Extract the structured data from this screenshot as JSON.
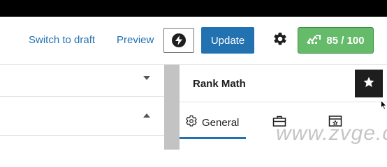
{
  "toolbar": {
    "switch_to_draft_label": "Switch to draft",
    "preview_label": "Preview",
    "bolt_icon": "bolt-icon",
    "update_label": "Update",
    "settings_icon": "gear-icon",
    "seo_score_label": "85 / 100",
    "seo_score_icon": "rank-math-icon"
  },
  "left_panels": [
    {
      "state": "collapsed",
      "arrow": "chevron-down-icon"
    },
    {
      "state": "expanded",
      "arrow": "chevron-up-icon"
    }
  ],
  "sidebar": {
    "title": "Rank Math",
    "star_icon": "star-icon",
    "tabs": [
      {
        "label": "General",
        "icon": "gear-icon",
        "active": true
      },
      {
        "label": "",
        "icon": "toolbox-icon",
        "active": false
      },
      {
        "label": "",
        "icon": "schema-icon",
        "active": false
      }
    ]
  },
  "watermark": "www.zvge.cn",
  "colors": {
    "accent": "#2271b1",
    "score_green": "#66bb6a",
    "top_bar": "#000000"
  }
}
